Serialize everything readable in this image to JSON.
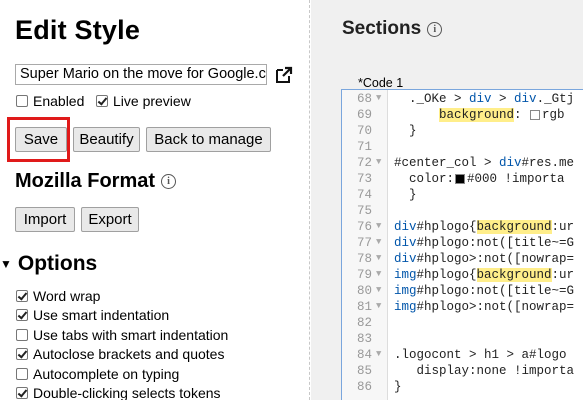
{
  "sidebar": {
    "title": "Edit Style",
    "style_name": "Super Mario on the move for Google.c",
    "enabled_label": "Enabled",
    "live_preview_label": "Live preview",
    "buttons": {
      "save": "Save",
      "beautify": "Beautify",
      "back": "Back to manage"
    },
    "mozilla_format": "Mozilla Format",
    "import": "Import",
    "export": "Export",
    "options_title": "Options",
    "options": [
      {
        "label": "Word wrap",
        "checked": true
      },
      {
        "label": "Use smart indentation",
        "checked": true
      },
      {
        "label": "Use tabs with smart indentation",
        "checked": false
      },
      {
        "label": "Autoclose brackets and quotes",
        "checked": true
      },
      {
        "label": "Autocomplete on typing",
        "checked": false
      },
      {
        "label": "Double-clicking selects tokens",
        "checked": true
      }
    ]
  },
  "main": {
    "sections_title": "Sections",
    "code_label": "*Code 1",
    "lines": [
      {
        "n": "68",
        "fold": true,
        "parts": [
          [
            "t",
            "  ._OKe > "
          ],
          [
            "s",
            "div"
          ],
          [
            "t",
            " > "
          ],
          [
            "s",
            "div"
          ],
          [
            "t",
            "._Gtj"
          ]
        ]
      },
      {
        "n": "69",
        "fold": false,
        "parts": [
          [
            "t",
            "      "
          ],
          [
            "h",
            "background"
          ],
          [
            "t",
            ": "
          ],
          [
            "sw",
            ""
          ],
          [
            "t",
            "rgb"
          ]
        ]
      },
      {
        "n": "70",
        "fold": false,
        "parts": [
          [
            "t",
            "  }"
          ]
        ]
      },
      {
        "n": "71",
        "fold": false,
        "parts": [
          [
            "t",
            ""
          ]
        ]
      },
      {
        "n": "72",
        "fold": true,
        "parts": [
          [
            "t",
            "#center_col > "
          ],
          [
            "s",
            "div"
          ],
          [
            "t",
            "#res.me"
          ]
        ]
      },
      {
        "n": "73",
        "fold": false,
        "parts": [
          [
            "t",
            "  color:"
          ],
          [
            "bk",
            ""
          ],
          [
            "t",
            "#000 !importa"
          ]
        ]
      },
      {
        "n": "74",
        "fold": false,
        "parts": [
          [
            "t",
            "  }"
          ]
        ]
      },
      {
        "n": "75",
        "fold": false,
        "parts": [
          [
            "t",
            ""
          ]
        ]
      },
      {
        "n": "76",
        "fold": true,
        "parts": [
          [
            "s",
            "div"
          ],
          [
            "t",
            "#hplogo{"
          ],
          [
            "h",
            "background"
          ],
          [
            "t",
            ":ur"
          ]
        ]
      },
      {
        "n": "77",
        "fold": true,
        "parts": [
          [
            "s",
            "div"
          ],
          [
            "t",
            "#hplogo:not([title~=G"
          ]
        ]
      },
      {
        "n": "78",
        "fold": true,
        "parts": [
          [
            "s",
            "div"
          ],
          [
            "t",
            "#hplogo>:not([nowrap="
          ]
        ]
      },
      {
        "n": "79",
        "fold": true,
        "parts": [
          [
            "s",
            "img"
          ],
          [
            "t",
            "#hplogo{"
          ],
          [
            "h",
            "background"
          ],
          [
            "t",
            ":ur"
          ]
        ]
      },
      {
        "n": "80",
        "fold": true,
        "parts": [
          [
            "s",
            "img"
          ],
          [
            "t",
            "#hplogo:not([title~=G"
          ]
        ]
      },
      {
        "n": "81",
        "fold": true,
        "parts": [
          [
            "s",
            "img"
          ],
          [
            "t",
            "#hplogo>:not([nowrap="
          ]
        ]
      },
      {
        "n": "82",
        "fold": false,
        "parts": [
          [
            "t",
            ""
          ]
        ]
      },
      {
        "n": "83",
        "fold": false,
        "parts": [
          [
            "t",
            ""
          ]
        ]
      },
      {
        "n": "84",
        "fold": true,
        "parts": [
          [
            "t",
            ".logocont > h1 > a#logo"
          ]
        ]
      },
      {
        "n": "85",
        "fold": false,
        "parts": [
          [
            "t",
            "   display:none !importa"
          ]
        ]
      },
      {
        "n": "86",
        "fold": false,
        "parts": [
          [
            "t",
            "}"
          ]
        ]
      }
    ]
  },
  "colors": {
    "highlight_border": "#e01a1a",
    "editor_border": "#7aa6dd",
    "token_highlight": "#ffee8a"
  },
  "icons": {
    "external": "external-link-icon",
    "info": "info-icon",
    "collapse": "triangle-down-icon"
  }
}
